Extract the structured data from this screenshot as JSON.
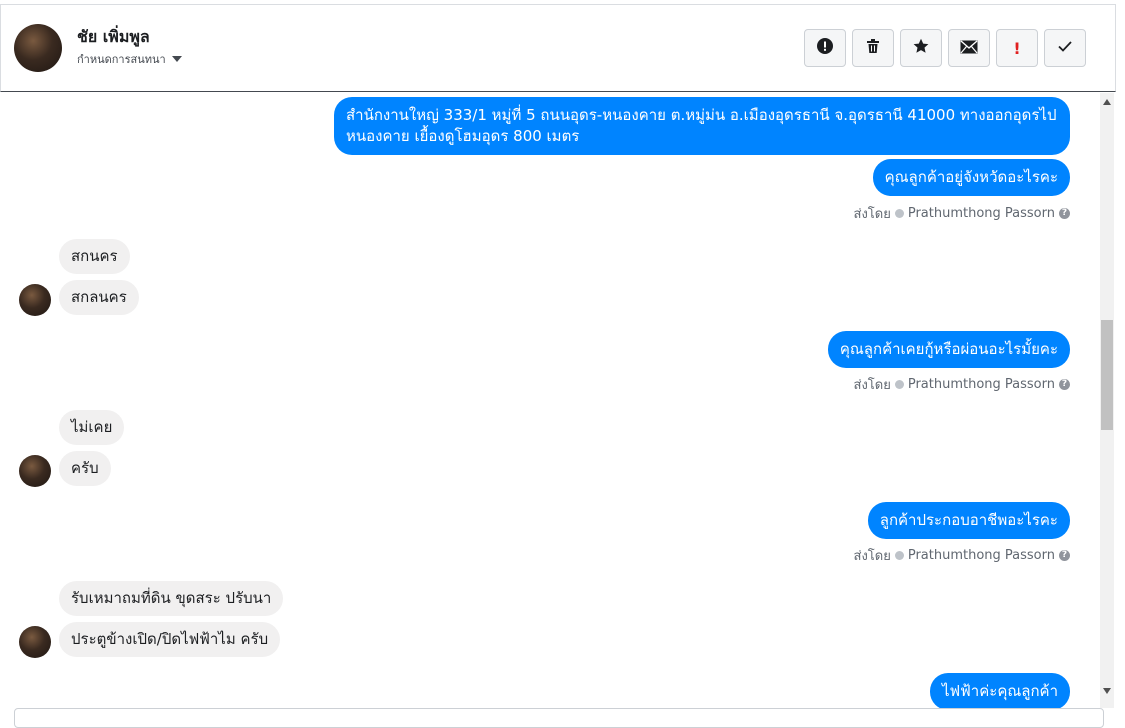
{
  "header": {
    "name": "ชัย เพิ่มพูล",
    "assign_label": "กำหนดการสนทนา"
  },
  "toolbar": {
    "buttons": [
      {
        "icon": "alert-circle-icon",
        "glyph": "❗"
      },
      {
        "icon": "trash-icon",
        "glyph": "🗑"
      },
      {
        "icon": "star-icon",
        "glyph": "★"
      },
      {
        "icon": "envelope-icon",
        "glyph": "✉"
      },
      {
        "icon": "exclamation-icon",
        "glyph": "!"
      },
      {
        "icon": "check-icon",
        "glyph": "✓"
      }
    ]
  },
  "messages": {
    "m1": "สำนักงานใหญ่ 333/1 หมู่ที่ 5 ถนนอุดร-หนองคาย ต.หมู่ม่น อ.เมืองอุดรธานี จ.อุดรธานี 41000 ทางออกอุดรไปหนองคาย เยื้องดูโฮมอุดร 800 เมตร",
    "m2": "คุณลูกค้าอยู่จังหวัดอะไรคะ",
    "m3": "สกนคร",
    "m4": "สกลนคร",
    "m5": "คุณลูกค้าเคยกู้หรือผ่อนอะไรมั้ยคะ",
    "m6": "ไม่เคย",
    "m7": "ครับ",
    "m8": "ลูกค้าประกอบอาชีพอะไรคะ",
    "m9": "รับเหมาถมที่ดิน ขุดสระ ปรับนา",
    "m10": "ประตูข้างเปิด/ปิดไฟฟ้าไม ครับ",
    "m11": "ไฟฟ้าค่ะคุณลูกค้า"
  },
  "sender": {
    "prefix": "ส่งโดย",
    "name": "Prathumthong Passorn"
  }
}
